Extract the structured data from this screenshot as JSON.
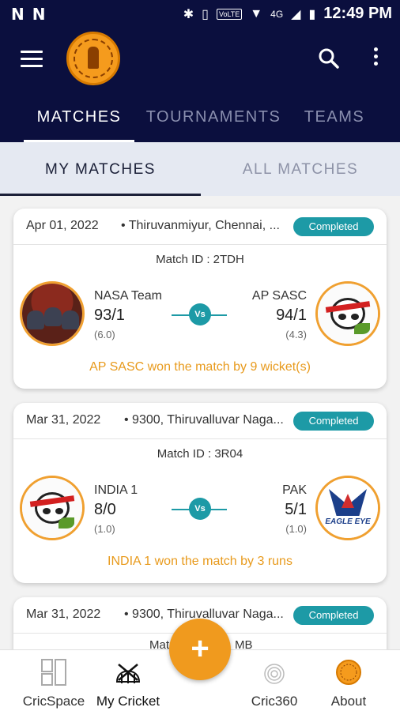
{
  "status_bar": {
    "time": "12:49 PM",
    "carrier_icons": [
      "N",
      "N"
    ],
    "volte": "VoLTE",
    "network": "4G"
  },
  "app_bar": {
    "tabs": [
      {
        "label": "MATCHES",
        "active": true
      },
      {
        "label": "TOURNAMENTS",
        "active": false
      },
      {
        "label": "TEAMS",
        "active": false
      }
    ]
  },
  "sub_tabs": [
    {
      "label": "MY MATCHES",
      "active": true
    },
    {
      "label": "ALL MATCHES",
      "active": false
    }
  ],
  "matches": [
    {
      "date": "Apr 01, 2022",
      "venue": "• Thiruvanmiyur, Chennai, ...",
      "status": "Completed",
      "match_id": "Match ID : 2TDH",
      "team1": {
        "name": "NASA Team",
        "score": "93/1",
        "overs": "(6.0)",
        "logo": "nasa-logo"
      },
      "team2": {
        "name": "AP SASC",
        "score": "94/1",
        "overs": "(4.3)",
        "logo": "panda-logo"
      },
      "vs": "Vs",
      "result": "AP SASC won the match by 9 wicket(s)"
    },
    {
      "date": "Mar 31, 2022",
      "venue": "• 9300, Thiruvalluvar Naga...",
      "status": "Completed",
      "match_id": "Match ID : 3R04",
      "team1": {
        "name": "INDIA 1",
        "score": "8/0",
        "overs": "(1.0)",
        "logo": "panda-logo"
      },
      "team2": {
        "name": "PAK",
        "score": "5/1",
        "overs": "(1.0)",
        "logo": "eagle-eye-logo",
        "logo_text": "EAGLE EYE"
      },
      "vs": "Vs",
      "result": "INDIA 1 won the match by 3 runs"
    },
    {
      "date": "Mar 31, 2022",
      "venue": "• 9300, Thiruvalluvar Naga...",
      "status": "Completed",
      "match_id_partial": "Mat",
      "match_id_tail": "MB"
    }
  ],
  "fab": {
    "label": "+"
  },
  "bottom_nav": [
    {
      "label": "CricSpace",
      "icon": "cricspace-icon",
      "active": false
    },
    {
      "label": "My Cricket",
      "icon": "cricket-icon",
      "active": true
    },
    {
      "label": "Cric360",
      "icon": "cric360-icon",
      "active": false
    },
    {
      "label": "About",
      "icon": "about-logo-icon",
      "active": false
    }
  ],
  "colors": {
    "primary": "#0b0f3e",
    "accent": "#f09a1e",
    "teal": "#1d9aa6",
    "result": "#e89a1c"
  }
}
